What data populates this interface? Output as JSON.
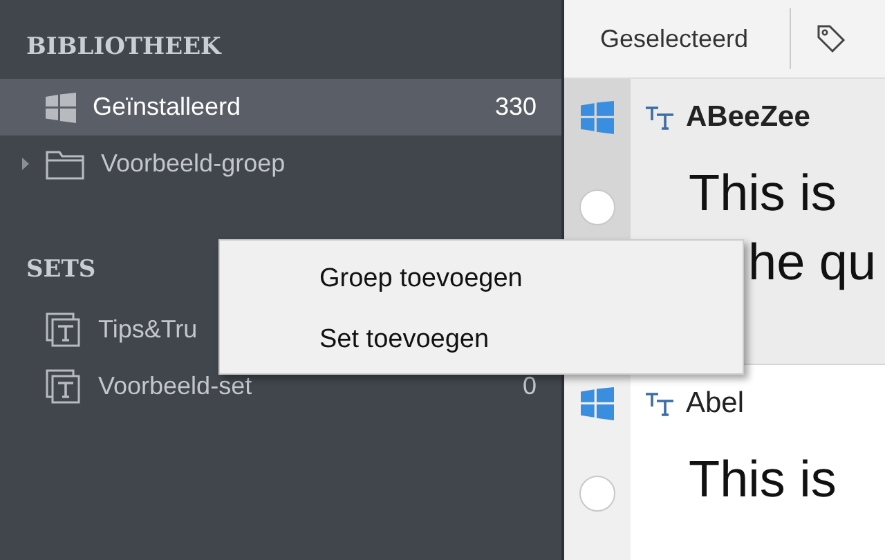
{
  "sidebar": {
    "sections": [
      {
        "title": "BIBLIOTHEEK",
        "items": [
          {
            "kind": "windows",
            "label": "Geïnstalleerd",
            "count": "330",
            "selected": true
          },
          {
            "kind": "folder",
            "label": "Voorbeeld-groep",
            "selected": false,
            "expanded": false
          }
        ]
      },
      {
        "title": "SETS",
        "items": [
          {
            "kind": "set",
            "label": "Tips&Tru",
            "selected": false
          },
          {
            "kind": "set",
            "label": "Voorbeeld-set",
            "count": "0",
            "selected": false
          }
        ]
      }
    ]
  },
  "toolbar": {
    "label": "Geselecteerd"
  },
  "fonts": [
    {
      "name": "ABeeZee",
      "selected": true,
      "preview": [
        "This is",
        "he qu"
      ]
    },
    {
      "name": "Abel",
      "selected": false,
      "preview": [
        "This is"
      ]
    }
  ],
  "context_menu": {
    "items": [
      "Groep toevoegen",
      "Set toevoegen"
    ]
  }
}
